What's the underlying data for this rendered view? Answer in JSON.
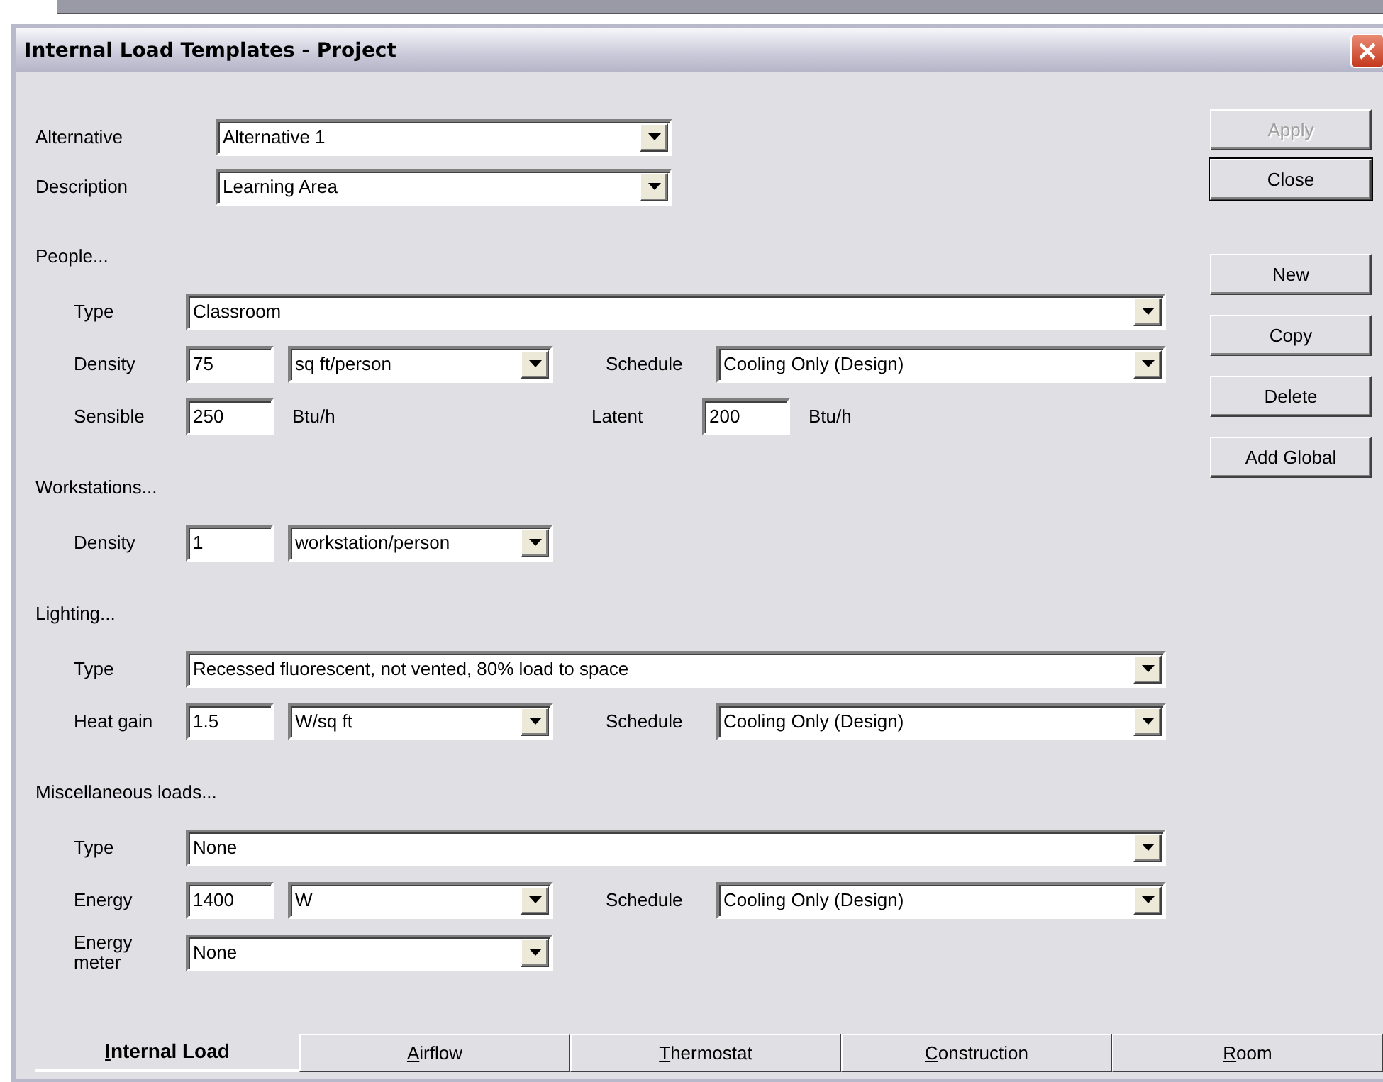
{
  "window": {
    "title": "Internal Load Templates - Project"
  },
  "header": [
    {
      "label": "Alternative",
      "value": "Alternative 1"
    },
    {
      "label": "Description",
      "value": "Learning Area"
    }
  ],
  "sections": [
    {
      "title": "People...",
      "rows": [
        {
          "kind": "type",
          "label": "Type",
          "value": "Classroom"
        },
        {
          "kind": "quantity",
          "label": "Density",
          "value": "75",
          "unit": {
            "kind": "combo",
            "text": "sq ft/person"
          },
          "right": {
            "label": "Schedule",
            "kind": "combo",
            "value": "Cooling Only (Design)"
          }
        },
        {
          "kind": "quantity",
          "label": "Sensible",
          "value": "250",
          "unit": {
            "kind": "text",
            "text": "Btu/h"
          },
          "right": {
            "label": "Latent",
            "kind": "edit",
            "value": "200",
            "unit": "Btu/h"
          }
        }
      ]
    },
    {
      "title": "Workstations...",
      "rows": [
        {
          "kind": "quantity",
          "label": "Density",
          "value": "1",
          "unit": {
            "kind": "combo",
            "text": "workstation/person"
          }
        }
      ]
    },
    {
      "title": "Lighting...",
      "rows": [
        {
          "kind": "type",
          "label": "Type",
          "value": "Recessed fluorescent, not vented, 80% load to space"
        },
        {
          "kind": "quantity",
          "label": "Heat gain",
          "value": "1.5",
          "unit": {
            "kind": "combo",
            "text": "W/sq ft"
          },
          "right": {
            "label": "Schedule",
            "kind": "combo",
            "value": "Cooling Only (Design)"
          }
        }
      ]
    },
    {
      "title": "Miscellaneous loads...",
      "rows": [
        {
          "kind": "type",
          "label": "Type",
          "value": "None"
        },
        {
          "kind": "quantity",
          "label": "Energy",
          "value": "1400",
          "unit": {
            "kind": "combo",
            "text": "W"
          },
          "right": {
            "label": "Schedule",
            "kind": "combo",
            "value": "Cooling Only (Design)"
          }
        },
        {
          "kind": "meter",
          "label": "Energy meter",
          "value": "None"
        }
      ]
    }
  ],
  "buttons": [
    {
      "label": "Apply",
      "disabled": true,
      "default": false
    },
    {
      "label": "Close",
      "disabled": false,
      "default": true
    },
    {
      "label": "New",
      "disabled": false,
      "default": false
    },
    {
      "label": "Copy",
      "disabled": false,
      "default": false
    },
    {
      "label": "Delete",
      "disabled": false,
      "default": false
    },
    {
      "label": "Add Global",
      "disabled": false,
      "default": false
    }
  ],
  "tabs": [
    {
      "label": "Internal Load",
      "access_key_underlined": true,
      "selected": true
    },
    {
      "label": "Airflow",
      "access_key_underlined": true,
      "selected": false
    },
    {
      "label": "Thermostat",
      "access_key_underlined": true,
      "selected": false
    },
    {
      "label": "Construction",
      "access_key_underlined": true,
      "selected": false
    },
    {
      "label": "Room",
      "access_key_underlined": true,
      "selected": false
    }
  ]
}
